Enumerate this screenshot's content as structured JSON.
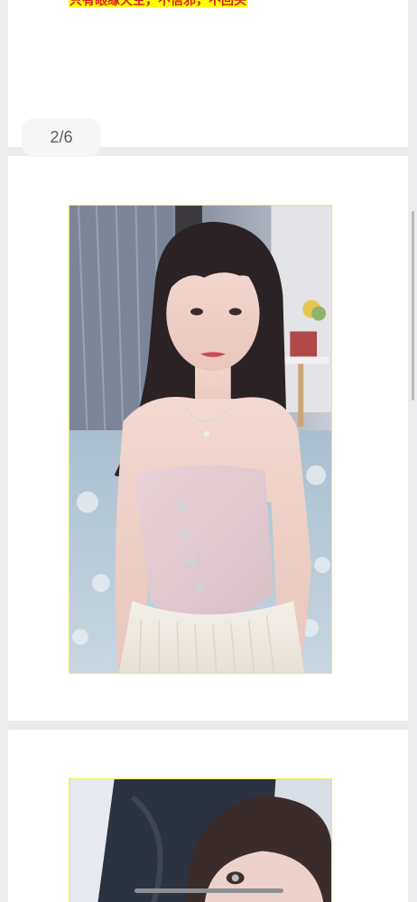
{
  "post": {
    "highlight_text": "只有眼缘天空，不信邪，不回头",
    "page_counter": "2/6"
  },
  "images": [
    {
      "description_icon": "photo-portrait-woman-strapless-top"
    },
    {
      "description_icon": "photo-selfie-woman-bangs"
    }
  ],
  "colors": {
    "background": "#ececee",
    "card": "#ffffff",
    "highlight_bg": "#ffff00",
    "highlight_text": "#d62020",
    "photo_border": "#f2ef3a",
    "counter_bg": "#f6f6f7",
    "counter_text": "#5c5c60"
  }
}
